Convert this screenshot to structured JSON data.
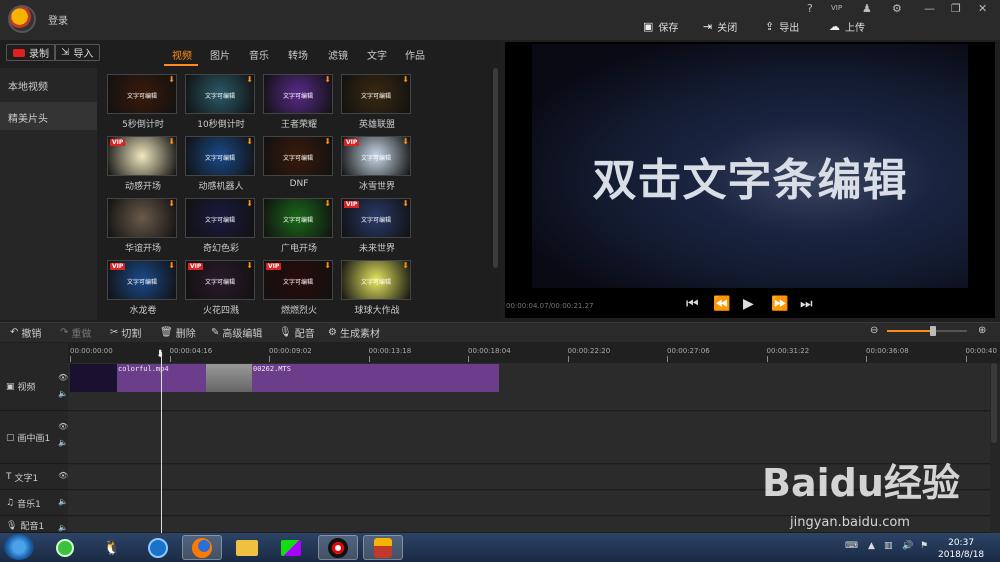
{
  "header": {
    "login": "登录",
    "window_controls": [
      "?",
      "VIP",
      "♟",
      "⚙",
      "—",
      "❐",
      "✕"
    ],
    "buttons": [
      {
        "label": "保存",
        "icon": "save-icon"
      },
      {
        "label": "关闭",
        "icon": "exit-icon"
      },
      {
        "label": "导出",
        "icon": "export-icon"
      },
      {
        "label": "上传",
        "icon": "upload-icon"
      }
    ]
  },
  "media": {
    "record": "录制",
    "import": "导入",
    "tabs": [
      "视频",
      "图片",
      "音乐",
      "转场",
      "滤镜",
      "文字",
      "作品"
    ],
    "active_tab": "视频",
    "categories": [
      "本地视频",
      "精美片头"
    ],
    "selected_category": "精美片头",
    "items": [
      {
        "name": "5秒倒计时",
        "vip": false,
        "text": "文字可编辑"
      },
      {
        "name": "10秒倒计时",
        "vip": false,
        "text": "文字可编辑"
      },
      {
        "name": "王者荣耀",
        "vip": false,
        "text": "文字可编辑"
      },
      {
        "name": "英雄联盟",
        "vip": false,
        "text": "文字可编辑"
      },
      {
        "name": "动感开场",
        "vip": true,
        "text": ""
      },
      {
        "name": "动感机器人",
        "vip": false,
        "text": "文字可编辑"
      },
      {
        "name": "DNF",
        "vip": false,
        "text": "文字可编辑"
      },
      {
        "name": "冰雪世界",
        "vip": true,
        "text": "文字可编辑"
      },
      {
        "name": "华谊开场",
        "vip": false,
        "text": ""
      },
      {
        "name": "奇幻色彩",
        "vip": false,
        "text": "文字可编辑"
      },
      {
        "name": "广电开场",
        "vip": false,
        "text": "文字可编辑"
      },
      {
        "name": "未来世界",
        "vip": true,
        "text": "文字可编辑"
      },
      {
        "name": "水龙卷",
        "vip": true,
        "text": "文字可编辑"
      },
      {
        "name": "火花四溅",
        "vip": true,
        "text": "文字可编辑"
      },
      {
        "name": "燃燃烈火",
        "vip": true,
        "text": "文字可编辑"
      },
      {
        "name": "球球大作战",
        "vip": false,
        "text": "文字可编辑"
      }
    ]
  },
  "preview": {
    "text": "双击文字条编辑",
    "timecode": "00:00:04.07/00:00:21.27"
  },
  "toolbar": {
    "items": [
      "撤销",
      "重做",
      "切割",
      "删除",
      "高级编辑",
      "配音",
      "生成素材"
    ]
  },
  "timeline": {
    "ruler": [
      "00:00:00:00",
      "00:00:04:16",
      "00:00:09:02",
      "00:00:13:18",
      "00:00:18:04",
      "00:00:22:20",
      "00:00:27:06",
      "00:00:31:22",
      "00:00:36:08",
      "00:00:40"
    ],
    "tracks": [
      "视频",
      "画中画1",
      "文字1",
      "音乐1",
      "配音1"
    ],
    "clips": [
      "colorful.mp4",
      "00262.MTS"
    ]
  },
  "taskbar": {
    "time": "20:37",
    "date": "2018/8/18"
  },
  "watermark": {
    "logo": "Baidu经验",
    "url": "jingyan.baidu.com"
  }
}
